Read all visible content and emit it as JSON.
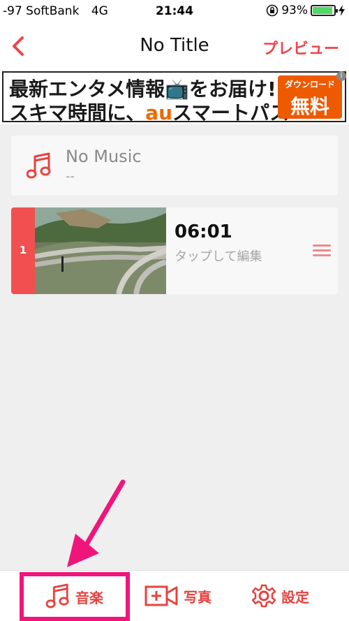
{
  "status_bar": {
    "carrier": "-97 SoftBank",
    "network": "4G",
    "time": "21:44",
    "battery": "93%",
    "battery_level": 0.93
  },
  "nav": {
    "title": "No Title",
    "preview_label": "プレビュー",
    "accent": "#f0434a"
  },
  "ad": {
    "line1": "最新エンタメ情報📺をお届け!",
    "line2_pre": "スキマ時間に、",
    "line2_au": "au",
    "line2_post": "スマートパス",
    "box_small": "ダウンロード",
    "box_big": "無料",
    "info": "i"
  },
  "music": {
    "title": "No Music",
    "subtitle": "--"
  },
  "clips": [
    {
      "index": "1",
      "duration": "06:01",
      "hint": "タップして編集"
    }
  ],
  "tabs": {
    "music": "音楽",
    "photo": "写真",
    "settings": "設定"
  }
}
